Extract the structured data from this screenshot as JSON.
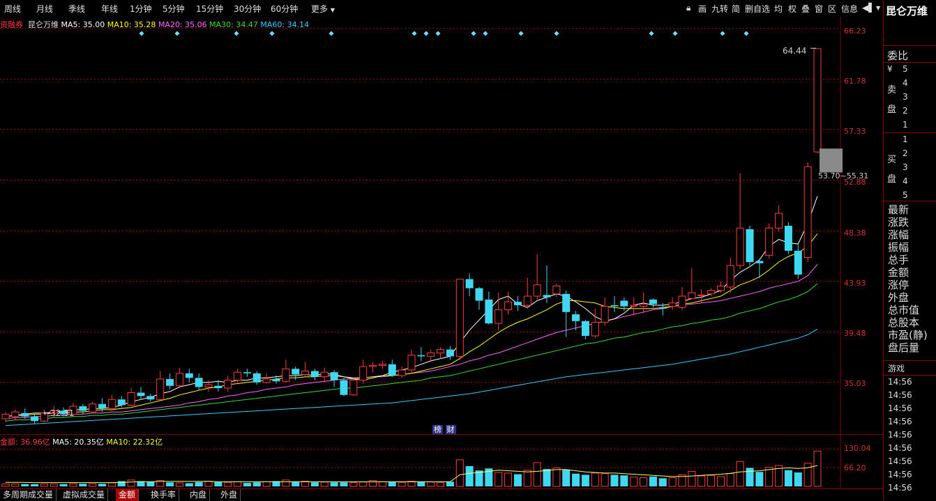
{
  "topbar": {
    "periods": [
      "周线",
      "月线",
      "季线",
      "年线",
      "1分钟",
      "5分钟",
      "15分钟",
      "30分钟",
      "60分钟",
      "更多"
    ],
    "tools": [
      "画",
      "九转",
      "简",
      "删自选",
      "均",
      "权",
      "叠",
      "窗",
      "区",
      "信息"
    ]
  },
  "stock": {
    "tag": "资融券",
    "name": "昆仑万维",
    "ma": [
      {
        "label": "MA5: 35.00",
        "color": "#ffffff"
      },
      {
        "label": "MA10: 35.28",
        "color": "#ffff00"
      },
      {
        "label": "MA20: 35.06",
        "color": "#ff66ff"
      },
      {
        "label": "MA30: 34.47",
        "color": "#33dd33"
      },
      {
        "label": "MA60: 34.14",
        "color": "#33ccff"
      }
    ]
  },
  "price_axis": [
    "66.23",
    "61.78",
    "57.33",
    "52.88",
    "48.38",
    "43.93",
    "39.48",
    "35.03"
  ],
  "annotations": {
    "high": "64.44",
    "low": "32.31",
    "range": "53.70~55.31",
    "tags": [
      "榜",
      "财"
    ]
  },
  "volume": {
    "label": "金额: 36.96亿",
    "ma5": "MA5: 20.35亿",
    "ma10": "MA10: 22.32亿",
    "axis": [
      "130.04",
      "66.20"
    ]
  },
  "bottom_tabs": [
    "多周期成交量",
    "虚拟成交量",
    "金额",
    "换手率",
    "内盘",
    "外盘"
  ],
  "active_tab": "金额",
  "right_panel": {
    "title": "昆仑万维",
    "weibi": "委比",
    "currency": "¥",
    "sell_label": [
      "卖",
      "盘"
    ],
    "buy_label": [
      "买",
      "盘"
    ],
    "sell_levels": [
      "5",
      "4",
      "3",
      "2",
      "1"
    ],
    "buy_levels": [
      "1",
      "2",
      "3",
      "4",
      "5"
    ],
    "stats": [
      "最新",
      "涨跌",
      "涨幅",
      "振幅",
      "总手",
      "金额",
      "涨停",
      "外盘",
      "总市值",
      "总股本",
      "市盈(静)",
      "盘后量"
    ],
    "game": "游戏",
    "times": [
      "14:56",
      "14:56",
      "14:56",
      "14:56",
      "14:56",
      "14:56",
      "14:56",
      "14:56",
      "14:56",
      "14:56"
    ]
  },
  "chart_data": {
    "type": "candlestick",
    "candles": [
      [
        31.8,
        32.2,
        31.5,
        32.4
      ],
      [
        32.0,
        32.4,
        31.7,
        32.6
      ],
      [
        32.3,
        32.0,
        31.8,
        32.7
      ],
      [
        32.0,
        31.6,
        31.4,
        32.2
      ],
      [
        31.6,
        32.3,
        31.5,
        32.6
      ],
      [
        32.3,
        32.5,
        31.9,
        32.9
      ],
      [
        32.5,
        32.2,
        32.0,
        32.8
      ],
      [
        32.2,
        32.9,
        32.0,
        33.2
      ],
      [
        32.9,
        32.5,
        32.2,
        33.1
      ],
      [
        32.4,
        33.1,
        32.3,
        33.3
      ],
      [
        33.1,
        32.7,
        32.4,
        33.6
      ],
      [
        32.7,
        33.5,
        32.5,
        33.9
      ],
      [
        33.5,
        33.0,
        32.8,
        33.8
      ],
      [
        33.0,
        34.1,
        32.9,
        34.5
      ],
      [
        34.1,
        33.8,
        33.5,
        34.6
      ],
      [
        33.8,
        33.5,
        33.3,
        34.0
      ],
      [
        33.5,
        35.3,
        33.4,
        36.0
      ],
      [
        35.3,
        34.7,
        34.4,
        35.8
      ],
      [
        34.7,
        35.8,
        34.5,
        36.3
      ],
      [
        35.8,
        35.4,
        35.0,
        36.2
      ],
      [
        35.4,
        34.6,
        34.3,
        35.8
      ],
      [
        34.6,
        34.8,
        34.2,
        35.2
      ],
      [
        34.7,
        34.5,
        34.2,
        35.2
      ],
      [
        34.5,
        35.2,
        34.2,
        35.6
      ],
      [
        35.2,
        35.9,
        35.0,
        36.2
      ],
      [
        35.9,
        35.8,
        35.5,
        36.2
      ],
      [
        35.8,
        35.0,
        34.8,
        36.0
      ],
      [
        35.0,
        35.3,
        34.9,
        35.8
      ],
      [
        35.3,
        35.1,
        34.9,
        35.6
      ],
      [
        35.1,
        36.2,
        35.0,
        37.0
      ],
      [
        36.2,
        35.7,
        35.2,
        36.4
      ],
      [
        35.7,
        36.0,
        35.5,
        36.8
      ],
      [
        36.0,
        35.5,
        35.2,
        36.2
      ],
      [
        35.5,
        35.9,
        35.0,
        36.3
      ],
      [
        35.9,
        35.2,
        34.6,
        36.1
      ],
      [
        35.2,
        33.9,
        33.8,
        35.4
      ],
      [
        33.9,
        35.2,
        33.8,
        35.3
      ],
      [
        35.2,
        36.4,
        34.9,
        37.0
      ],
      [
        36.4,
        36.5,
        35.9,
        36.8
      ],
      [
        36.5,
        36.6,
        36.2,
        36.9
      ],
      [
        36.6,
        35.6,
        35.5,
        37.0
      ],
      [
        35.6,
        36.1,
        35.4,
        36.4
      ],
      [
        36.1,
        37.4,
        35.8,
        37.9
      ],
      [
        37.4,
        37.3,
        36.9,
        38.1
      ],
      [
        37.3,
        37.6,
        36.8,
        37.9
      ],
      [
        37.6,
        37.9,
        37.1,
        38.1
      ],
      [
        37.9,
        37.3,
        37.0,
        38.2
      ],
      [
        37.3,
        44.1,
        37.0,
        44.1
      ],
      [
        44.1,
        43.3,
        42.6,
        44.6
      ],
      [
        43.3,
        42.2,
        41.4,
        43.4
      ],
      [
        42.3,
        40.2,
        40.1,
        43.0
      ],
      [
        40.2,
        41.4,
        39.6,
        42.9
      ],
      [
        41.4,
        42.1,
        41.0,
        43.0
      ],
      [
        42.1,
        41.8,
        41.3,
        42.6
      ],
      [
        41.8,
        42.6,
        41.5,
        44.2
      ],
      [
        42.6,
        43.6,
        42.3,
        46.3
      ],
      [
        42.7,
        42.5,
        42.0,
        45.3
      ],
      [
        42.8,
        43.5,
        42.5,
        43.7
      ],
      [
        42.8,
        41.2,
        39.0,
        43.1
      ],
      [
        41.0,
        40.4,
        39.6,
        41.3
      ],
      [
        40.4,
        39.1,
        38.8,
        40.5
      ],
      [
        39.1,
        40.3,
        38.9,
        41.5
      ],
      [
        40.3,
        41.7,
        40.0,
        42.5
      ],
      [
        41.8,
        41.7,
        41.2,
        42.6
      ],
      [
        42.2,
        41.7,
        41.3,
        42.5
      ],
      [
        41.7,
        41.8,
        40.9,
        42.5
      ],
      [
        41.7,
        41.9,
        41.1,
        42.9
      ],
      [
        42.3,
        41.9,
        41.6,
        42.4
      ],
      [
        41.6,
        41.5,
        40.9,
        42.0
      ],
      [
        41.7,
        42.0,
        41.4,
        42.5
      ],
      [
        41.6,
        42.6,
        41.4,
        43.4
      ],
      [
        42.4,
        42.9,
        42.3,
        45.1
      ],
      [
        42.7,
        42.7,
        42.0,
        43.2
      ],
      [
        42.8,
        43.1,
        42.6,
        43.3
      ],
      [
        43.1,
        43.5,
        42.9,
        43.9
      ],
      [
        43.4,
        45.3,
        42.9,
        46.0
      ],
      [
        45.3,
        48.6,
        45.0,
        53.4
      ],
      [
        48.5,
        45.6,
        45.3,
        48.8
      ],
      [
        45.7,
        45.5,
        44.2,
        45.9
      ],
      [
        46.2,
        48.6,
        45.9,
        49.0
      ],
      [
        48.6,
        49.9,
        48.3,
        50.6
      ],
      [
        48.8,
        46.6,
        46.3,
        49.1
      ],
      [
        46.6,
        44.5,
        44.1,
        47.3
      ],
      [
        46.0,
        54.0,
        45.6,
        54.4
      ],
      [
        55.3,
        64.4,
        55.2,
        64.4
      ]
    ],
    "ma5": [
      32.0,
      32.1,
      32.2,
      32.3,
      32.3,
      32.4,
      32.5,
      32.6,
      32.6,
      32.7,
      32.7,
      32.8,
      33.0,
      33.3,
      33.5,
      33.7,
      34.0,
      34.2,
      34.6,
      34.8,
      35.0,
      35.0,
      35.1,
      35.0,
      35.2,
      35.2,
      35.4,
      35.4,
      35.5,
      35.6,
      35.6,
      35.7,
      35.6,
      35.8,
      35.7,
      35.5,
      35.3,
      35.2,
      35.4,
      35.6,
      35.9,
      36.1,
      36.3,
      36.6,
      36.9,
      37.1,
      37.3,
      38.5,
      39.6,
      40.5,
      41.4,
      42.3,
      42.6,
      41.9,
      41.6,
      42.2,
      42.5,
      42.8,
      42.6,
      42.1,
      41.5,
      40.8,
      40.4,
      40.6,
      41.1,
      41.8,
      42.0,
      41.8,
      41.8,
      41.9,
      42.1,
      42.4,
      42.5,
      42.8,
      43.1,
      44.0,
      44.7,
      45.2,
      45.8,
      47.0,
      47.6,
      47.3,
      47.2,
      49.0,
      51.4
    ],
    "ma10": [
      32.0,
      32.1,
      32.1,
      32.2,
      32.2,
      32.3,
      32.3,
      32.4,
      32.4,
      32.5,
      32.6,
      32.6,
      32.7,
      32.8,
      33.0,
      33.2,
      33.4,
      33.6,
      33.9,
      34.1,
      34.3,
      34.5,
      34.6,
      34.8,
      34.9,
      35.0,
      35.1,
      35.2,
      35.3,
      35.4,
      35.4,
      35.5,
      35.5,
      35.6,
      35.6,
      35.5,
      35.4,
      35.4,
      35.5,
      35.6,
      35.6,
      35.7,
      35.8,
      36.0,
      36.2,
      36.4,
      36.6,
      37.1,
      37.7,
      38.2,
      38.8,
      39.4,
      39.9,
      40.3,
      40.6,
      41.0,
      41.4,
      41.9,
      42.2,
      42.2,
      42.1,
      42.0,
      41.7,
      41.6,
      41.5,
      41.5,
      41.5,
      41.5,
      41.6,
      41.7,
      41.9,
      42.0,
      42.2,
      42.4,
      42.6,
      43.1,
      43.6,
      43.9,
      44.3,
      44.9,
      45.6,
      46.1,
      46.4,
      47.0,
      48.1
    ],
    "ma20": [
      31.8,
      31.9,
      31.9,
      32.0,
      32.0,
      32.1,
      32.1,
      32.2,
      32.2,
      32.3,
      32.3,
      32.4,
      32.4,
      32.5,
      32.6,
      32.7,
      32.8,
      32.9,
      33.0,
      33.2,
      33.3,
      33.5,
      33.6,
      33.8,
      33.9,
      34.1,
      34.2,
      34.4,
      34.5,
      34.6,
      34.8,
      34.9,
      35.0,
      35.1,
      35.2,
      35.3,
      35.3,
      35.4,
      35.5,
      35.5,
      35.6,
      35.7,
      35.8,
      35.9,
      36.0,
      36.2,
      36.4,
      36.6,
      36.9,
      37.1,
      37.4,
      37.6,
      37.9,
      38.2,
      38.5,
      38.8,
      39.1,
      39.4,
      39.6,
      39.8,
      40.0,
      40.2,
      40.4,
      40.6,
      40.8,
      41.0,
      41.2,
      41.4,
      41.5,
      41.7,
      41.8,
      41.9,
      42.0,
      42.1,
      42.2,
      42.4,
      42.6,
      42.8,
      43.0,
      43.3,
      43.5,
      43.7,
      43.9,
      44.4,
      45.4
    ],
    "ma30": [
      31.6,
      31.7,
      31.7,
      31.8,
      31.8,
      31.9,
      31.9,
      32.0,
      32.0,
      32.1,
      32.1,
      32.2,
      32.2,
      32.3,
      32.4,
      32.5,
      32.6,
      32.7,
      32.8,
      32.9,
      33.0,
      33.1,
      33.2,
      33.3,
      33.4,
      33.5,
      33.6,
      33.7,
      33.8,
      33.9,
      34.0,
      34.1,
      34.2,
      34.3,
      34.4,
      34.5,
      34.5,
      34.6,
      34.7,
      34.8,
      34.9,
      35.0,
      35.1,
      35.2,
      35.4,
      35.5,
      35.6,
      35.8,
      36.0,
      36.2,
      36.4,
      36.6,
      36.8,
      37.0,
      37.2,
      37.4,
      37.6,
      37.8,
      38.0,
      38.2,
      38.4,
      38.5,
      38.7,
      38.9,
      39.0,
      39.2,
      39.4,
      39.5,
      39.7,
      39.9,
      40.0,
      40.2,
      40.3,
      40.5,
      40.6,
      40.8,
      41.1,
      41.3,
      41.5,
      41.8,
      42.1,
      42.3,
      42.6,
      43.0,
      43.7
    ],
    "ma60": [
      31.2,
      31.25,
      31.3,
      31.35,
      31.4,
      31.45,
      31.5,
      31.55,
      31.6,
      31.65,
      31.7,
      31.75,
      31.8,
      31.85,
      31.9,
      31.95,
      32.0,
      32.05,
      32.1,
      32.15,
      32.2,
      32.25,
      32.3,
      32.35,
      32.4,
      32.45,
      32.5,
      32.55,
      32.6,
      32.65,
      32.7,
      32.75,
      32.8,
      32.85,
      32.9,
      32.95,
      33.0,
      33.05,
      33.1,
      33.15,
      33.2,
      33.3,
      33.4,
      33.5,
      33.6,
      33.7,
      33.8,
      33.9,
      34.0,
      34.15,
      34.3,
      34.45,
      34.6,
      34.75,
      34.9,
      35.05,
      35.2,
      35.35,
      35.5,
      35.6,
      35.7,
      35.8,
      35.9,
      36.0,
      36.1,
      36.2,
      36.3,
      36.4,
      36.5,
      36.6,
      36.75,
      36.9,
      37.05,
      37.2,
      37.35,
      37.5,
      37.7,
      37.9,
      38.1,
      38.3,
      38.5,
      38.7,
      38.9,
      39.2,
      39.7
    ],
    "volume": [
      8,
      8,
      8,
      8,
      8,
      8,
      8,
      9,
      9,
      9,
      9,
      12,
      18,
      22,
      18,
      16,
      20,
      14,
      12,
      11,
      15,
      18,
      15,
      14,
      16,
      12,
      14,
      16,
      18,
      22,
      16,
      18,
      14,
      15,
      14,
      14,
      13,
      15,
      20,
      16,
      15,
      14,
      18,
      16,
      15,
      14,
      16,
      92,
      70,
      55,
      62,
      48,
      46,
      42,
      56,
      82,
      60,
      64,
      58,
      44,
      40,
      46,
      44,
      40,
      38,
      32,
      30,
      34,
      28,
      30,
      40,
      52,
      36,
      38,
      34,
      44,
      86,
      64,
      50,
      66,
      72,
      56,
      48,
      80,
      122
    ],
    "vol_ma": [
      14,
      14,
      14,
      13,
      13,
      13,
      13,
      13,
      13,
      13,
      13,
      13,
      14,
      15,
      16,
      16,
      17,
      17,
      17,
      17,
      17,
      17,
      16,
      16,
      16,
      16,
      16,
      16,
      16,
      16,
      16,
      16,
      16,
      16,
      16,
      16,
      16,
      16,
      16,
      16,
      16,
      16,
      16,
      16,
      16,
      16,
      16,
      40,
      45,
      48,
      52,
      56,
      54,
      52,
      50,
      52,
      55,
      58,
      58,
      54,
      50,
      48,
      46,
      46,
      44,
      42,
      40,
      38,
      36,
      34,
      34,
      36,
      38,
      40,
      42,
      45,
      50,
      52,
      54,
      58,
      62,
      64,
      62,
      64,
      72
    ],
    "dots_x": [
      203,
      254,
      339,
      390,
      475,
      594,
      611,
      628,
      679,
      696,
      747,
      798,
      934,
      968,
      1036,
      1070
    ],
    "ylim": [
      31.0,
      66.6
    ],
    "vol_max": 130.04
  },
  "colors": {
    "up": "#ff3b3b",
    "down": "#3fd8f0",
    "grid": "#8b0000",
    "axis_text": "#d03030",
    "ma5": "#ffffff",
    "ma10": "#ffff00",
    "ma20": "#ff66ff",
    "ma30": "#33dd33",
    "ma60": "#33ccff"
  }
}
